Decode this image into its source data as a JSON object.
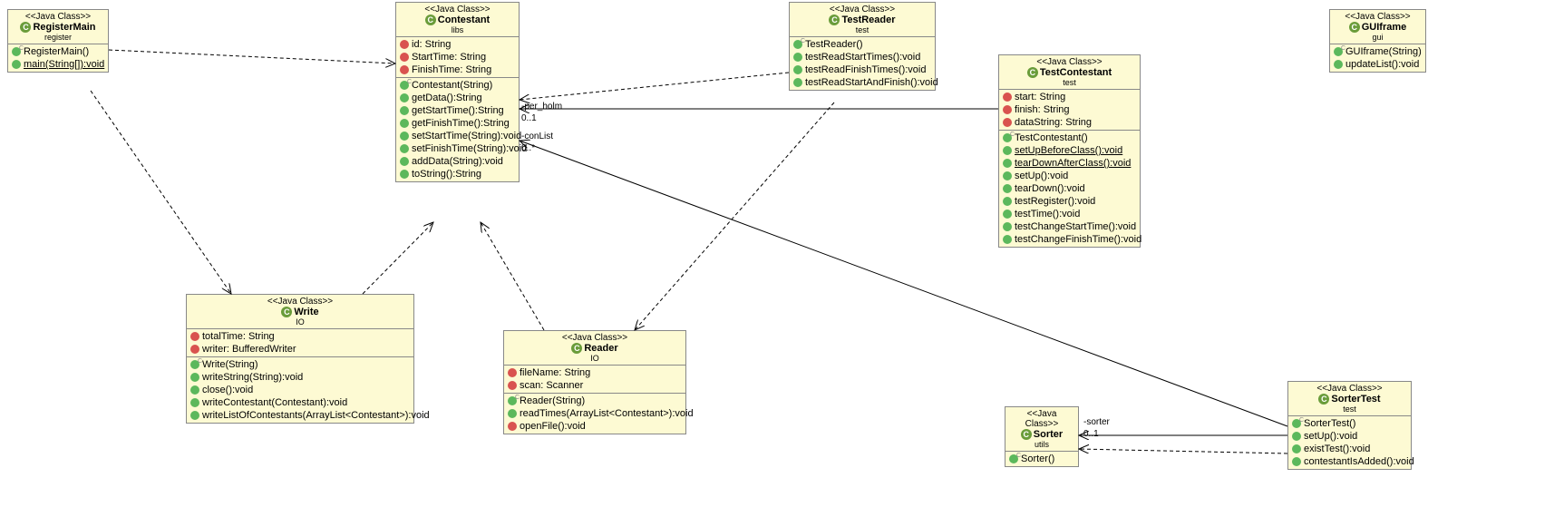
{
  "stereotype": "<<Java Class>>",
  "classes": {
    "registerMain": {
      "name": "RegisterMain",
      "package": "register",
      "attributes": [],
      "operations": [
        {
          "vis": "constructor",
          "sig": "RegisterMain()"
        },
        {
          "vis": "public",
          "sig": "main(String[]):void",
          "static": true
        }
      ]
    },
    "contestant": {
      "name": "Contestant",
      "package": "libs",
      "attributes": [
        {
          "vis": "private",
          "sig": "id: String"
        },
        {
          "vis": "private",
          "sig": "StartTime: String"
        },
        {
          "vis": "private",
          "sig": "FinishTime: String"
        }
      ],
      "operations": [
        {
          "vis": "constructor",
          "sig": "Contestant(String)"
        },
        {
          "vis": "public",
          "sig": "getData():String"
        },
        {
          "vis": "public",
          "sig": "getStartTime():String"
        },
        {
          "vis": "public",
          "sig": "getFinishTime():String"
        },
        {
          "vis": "public",
          "sig": "setStartTime(String):void"
        },
        {
          "vis": "public",
          "sig": "setFinishTime(String):void"
        },
        {
          "vis": "public",
          "sig": "addData(String):void"
        },
        {
          "vis": "public",
          "sig": "toString():String"
        }
      ]
    },
    "testReader": {
      "name": "TestReader",
      "package": "test",
      "attributes": [],
      "operations": [
        {
          "vis": "constructor",
          "sig": "TestReader()"
        },
        {
          "vis": "public",
          "sig": "testReadStartTimes():void"
        },
        {
          "vis": "public",
          "sig": "testReadFinishTimes():void"
        },
        {
          "vis": "public",
          "sig": "testReadStartAndFinish():void"
        }
      ]
    },
    "testContestant": {
      "name": "TestContestant",
      "package": "test",
      "attributes": [
        {
          "vis": "private",
          "sig": "start: String"
        },
        {
          "vis": "private",
          "sig": "finish: String"
        },
        {
          "vis": "private",
          "sig": "dataString: String"
        }
      ],
      "operations": [
        {
          "vis": "constructor",
          "sig": "TestContestant()"
        },
        {
          "vis": "public",
          "sig": "setUpBeforeClass():void",
          "static": true
        },
        {
          "vis": "public",
          "sig": "tearDownAfterClass():void",
          "static": true
        },
        {
          "vis": "public",
          "sig": "setUp():void"
        },
        {
          "vis": "public",
          "sig": "tearDown():void"
        },
        {
          "vis": "public",
          "sig": "testRegister():void"
        },
        {
          "vis": "public",
          "sig": "testTime():void"
        },
        {
          "vis": "public",
          "sig": "testChangeStartTime():void"
        },
        {
          "vis": "public",
          "sig": "testChangeFinishTime():void"
        }
      ]
    },
    "guiFrame": {
      "name": "GUIframe",
      "package": "gui",
      "attributes": [],
      "operations": [
        {
          "vis": "constructor",
          "sig": "GUIframe(String)"
        },
        {
          "vis": "public",
          "sig": "updateList():void"
        }
      ]
    },
    "write": {
      "name": "Write",
      "package": "IO",
      "attributes": [
        {
          "vis": "static-field",
          "sig": "totalTime: String"
        },
        {
          "vis": "private",
          "sig": "writer: BufferedWriter"
        }
      ],
      "operations": [
        {
          "vis": "constructor",
          "sig": "Write(String)"
        },
        {
          "vis": "public",
          "sig": "writeString(String):void"
        },
        {
          "vis": "public",
          "sig": "close():void"
        },
        {
          "vis": "public",
          "sig": "writeContestant(Contestant):void"
        },
        {
          "vis": "public",
          "sig": "writeListOfContestants(ArrayList<Contestant>):void"
        }
      ]
    },
    "reader": {
      "name": "Reader",
      "package": "IO",
      "attributes": [
        {
          "vis": "private",
          "sig": "fileName: String"
        },
        {
          "vis": "private",
          "sig": "scan: Scanner"
        }
      ],
      "operations": [
        {
          "vis": "constructor",
          "sig": "Reader(String)"
        },
        {
          "vis": "public",
          "sig": "readTimes(ArrayList<Contestant>):void"
        },
        {
          "vis": "private",
          "sig": "openFile():void"
        }
      ]
    },
    "sorter": {
      "name": "Sorter",
      "package": "utils",
      "attributes": [],
      "operations": [
        {
          "vis": "constructor",
          "sig": "Sorter()"
        }
      ]
    },
    "sorterTest": {
      "name": "SorterTest",
      "package": "test",
      "attributes": [],
      "operations": [
        {
          "vis": "constructor",
          "sig": "SorterTest()"
        },
        {
          "vis": "public",
          "sig": "setUp():void"
        },
        {
          "vis": "public",
          "sig": "existTest():void"
        },
        {
          "vis": "public",
          "sig": "contestantIsAdded():void"
        }
      ]
    }
  },
  "associations": {
    "perHolm": {
      "label": "-per_holm",
      "mult": "0..1"
    },
    "conList": {
      "label": "-conList",
      "mult": "0..*"
    },
    "sorter": {
      "label": "-sorter",
      "mult": "0..1"
    }
  }
}
